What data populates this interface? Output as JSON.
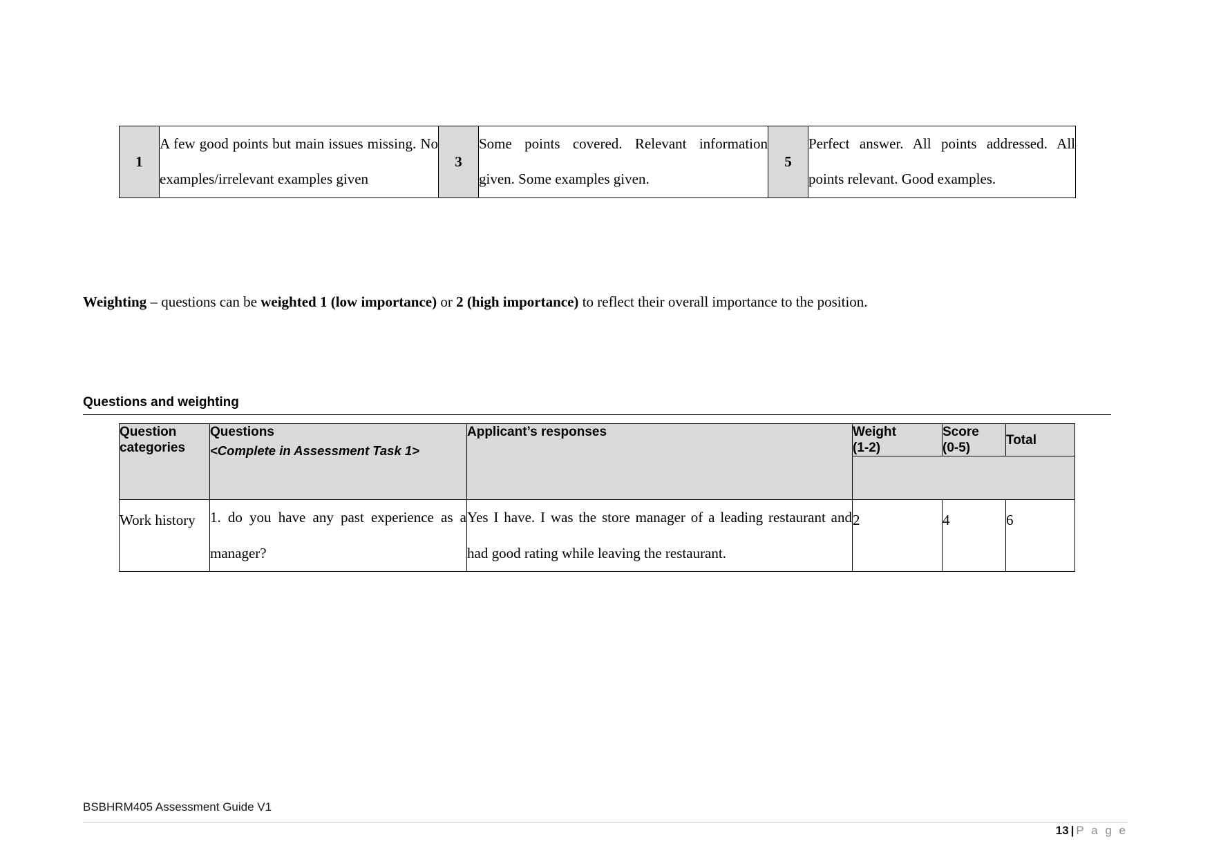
{
  "rubric": {
    "columns": [
      {
        "score": "1",
        "description": "A few good points but main issues missing. No examples/irrelevant examples given"
      },
      {
        "score": "3",
        "description": "Some points covered. Relevant information given. Some examples given."
      },
      {
        "score": "5",
        "description": "Perfect answer. All points addressed. All points relevant. Good examples."
      }
    ]
  },
  "weighting": {
    "lead": "Weighting",
    "part1": " – questions can be ",
    "bold1": "weighted 1 (low importance)",
    "part2": " or ",
    "bold2": "2 (high importance)",
    "part3": " to reflect their overall importance to the position."
  },
  "section": {
    "heading": "Questions and weighting"
  },
  "questions_table": {
    "headers": {
      "category": "Question categories",
      "questions": "Questions",
      "questions_note": "<Complete in Assessment Task 1>",
      "responses": "Applicant’s responses",
      "weight": "Weight (1-2)",
      "weight_line1": "Weight",
      "weight_line2": "(1-2)",
      "score": "Score (0-5)",
      "score_line1": "Score",
      "score_line2": "(0-5)",
      "total": "Total"
    },
    "rows": [
      {
        "category": "Work history",
        "question": "1. do you have any past experience as a manager?",
        "response": "Yes I have. I was the store manager of a leading restaurant and had good rating while leaving the restaurant.",
        "weight": "2",
        "score": "4",
        "total": "6"
      }
    ]
  },
  "footer": {
    "document_title": "BSBHRM405 Assessment Guide V1",
    "page_number": "13",
    "page_separator": "|",
    "page_word": "P a g e"
  },
  "colors": {
    "header_fill": "#d9d9d9",
    "border": "#000000",
    "footer_rule": "#c7c7c7",
    "page_word": "#8d8d8d"
  }
}
